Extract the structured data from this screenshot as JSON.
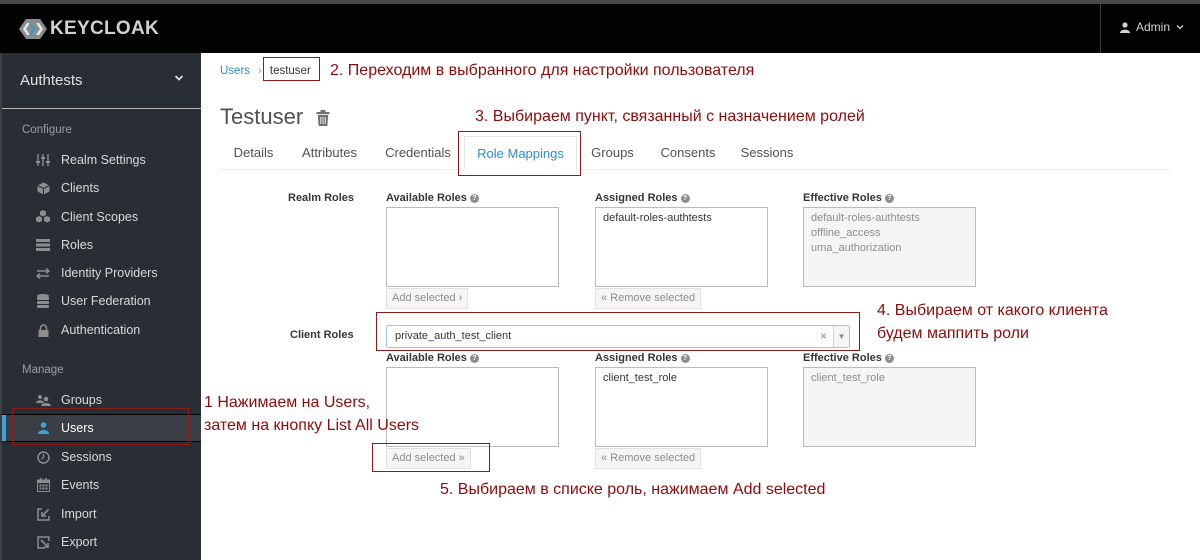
{
  "navbar": {
    "brand": "KEYCLOAK",
    "user": "Admin"
  },
  "sidebar": {
    "realm": "Authtests",
    "configure_title": "Configure",
    "configure_items": [
      {
        "label": "Realm Settings",
        "icon": "sliders-icon"
      },
      {
        "label": "Clients",
        "icon": "cube-icon"
      },
      {
        "label": "Client Scopes",
        "icon": "cubes-icon"
      },
      {
        "label": "Roles",
        "icon": "list-icon"
      },
      {
        "label": "Identity Providers",
        "icon": "exchange-icon"
      },
      {
        "label": "User Federation",
        "icon": "database-icon"
      },
      {
        "label": "Authentication",
        "icon": "lock-icon"
      }
    ],
    "manage_title": "Manage",
    "manage_items": [
      {
        "label": "Groups",
        "icon": "users-icon"
      },
      {
        "label": "Users",
        "icon": "user-icon",
        "active": true
      },
      {
        "label": "Sessions",
        "icon": "clock-icon"
      },
      {
        "label": "Events",
        "icon": "calendar-icon"
      },
      {
        "label": "Import",
        "icon": "import-icon"
      },
      {
        "label": "Export",
        "icon": "export-icon"
      }
    ]
  },
  "breadcrumb": {
    "parent": "Users",
    "current": "testuser"
  },
  "page": {
    "title": "Testuser"
  },
  "tabs": [
    {
      "label": "Details"
    },
    {
      "label": "Attributes"
    },
    {
      "label": "Credentials"
    },
    {
      "label": "Role Mappings",
      "active": true
    },
    {
      "label": "Groups"
    },
    {
      "label": "Consents"
    },
    {
      "label": "Sessions"
    }
  ],
  "realm_roles": {
    "label": "Realm Roles",
    "available_label": "Available Roles",
    "assigned_label": "Assigned Roles",
    "effective_label": "Effective Roles",
    "available": [],
    "assigned": [
      "default-roles-authtests"
    ],
    "effective": [
      "default-roles-authtests",
      "offline_access",
      "uma_authorization"
    ],
    "add_button": "Add selected ›",
    "remove_button": "« Remove selected"
  },
  "client_roles": {
    "label": "Client Roles",
    "selected_client": "private_auth_test_client",
    "available_label": "Available Roles",
    "assigned_label": "Assigned Roles",
    "effective_label": "Effective Roles",
    "available": [],
    "assigned": [
      "client_test_role"
    ],
    "effective": [
      "client_test_role"
    ],
    "add_button": "Add selected »",
    "remove_button": "« Remove selected"
  },
  "annotations": {
    "step1_line1": "1 Нажимаем на Users,",
    "step1_line2": "затем на кнопку List All Users",
    "step2": "2. Переходим в выбранного для настройки пользователя",
    "step3": "3. Выбираем пункт, связанный с назначением ролей",
    "step4_line1": "4. Выбираем от какого клиента",
    "step4_line2": "будем маппить роли",
    "step5": "5. Выбираем в списке роль, нажимаем Add selected"
  },
  "colors": {
    "accent": "#39a5dc",
    "link": "#2e8ccf",
    "annotation": "#8b0d0d",
    "sidebar_bg": "#292e34",
    "navbar_bg": "#030303"
  }
}
